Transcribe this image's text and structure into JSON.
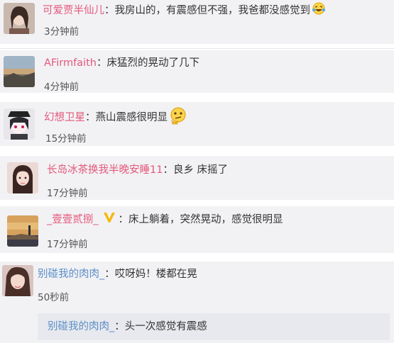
{
  "comments": [
    {
      "user": "可爱贾半仙儿",
      "sep": "：",
      "text": "我房山的，有震感但不强，我爸都没感觉到",
      "emoji": "laugh-cry-emoji",
      "time": "3分钟前"
    },
    {
      "user": "AFirmfaith",
      "sep": "：",
      "text": "床猛烈的晃动了几下",
      "time": "4分钟前"
    },
    {
      "user": "幻想卫星",
      "sep": "：",
      "text": "燕山震感很明显",
      "emoji": "thinking-emoji",
      "time": "15分钟前"
    },
    {
      "user": "长岛冰茶换我半晚安睡11",
      "sep": "：",
      "text": "良乡 床摇了",
      "time": "17分钟前"
    },
    {
      "user": "_壹壹贰捌_",
      "badge": "V",
      "sep": "：",
      "text": "床上躺着，突然晃动，感觉很明显",
      "time": "17分钟前"
    },
    {
      "user": "别碰我的肉肉_",
      "sep": "：",
      "text": "哎呀妈！楼都在晃",
      "time": "50秒前",
      "reply": {
        "user": "别碰我的肉肉_",
        "sep": "：",
        "text": "头一次感觉有震感"
      }
    }
  ],
  "colors": {
    "username_pink": "#e4587a",
    "username_blue": "#5b8ec6",
    "card_bg": "#f2f2f5",
    "badge": "#f5b800"
  }
}
